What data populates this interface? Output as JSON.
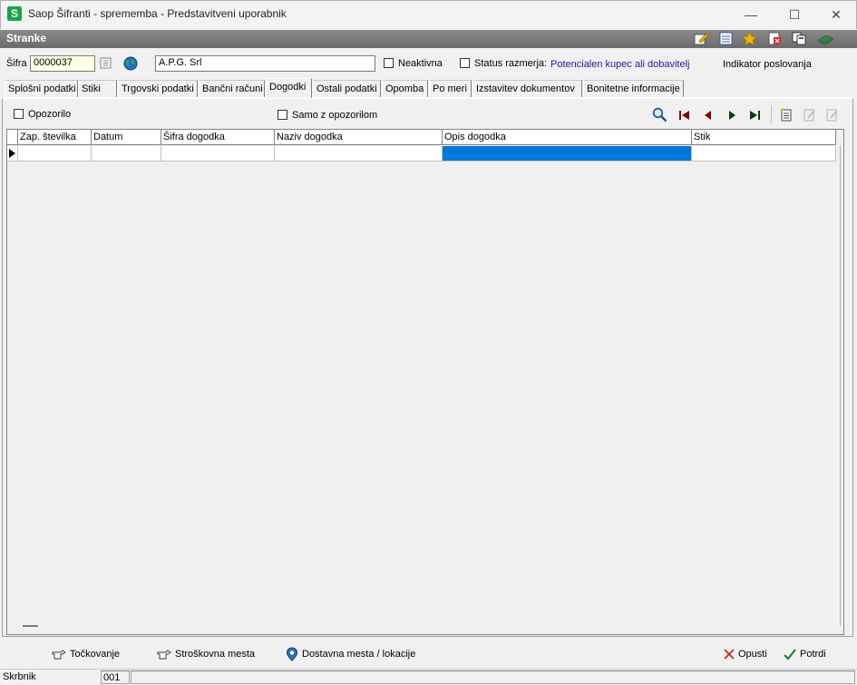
{
  "window": {
    "title": "Saop Šifranti - sprememba - Predstavitveni uporabnik",
    "minimize": "—",
    "maximize": "☐",
    "close": "✕"
  },
  "header": {
    "title": "Stranke"
  },
  "toolbar_icons": [
    "edit-icon",
    "list-icon",
    "star-icon",
    "delete-icon",
    "copy-icon",
    "book-icon"
  ],
  "fields": {
    "sifra_label": "Šifra",
    "sifra_value": "0000037",
    "name_value": "A.P.G. Srl",
    "neaktivna_label": "Neaktivna",
    "status_label": "Status razmerja:",
    "status_value": "Potencialen kupec ali dobavitelj",
    "indikator_label": "Indikator poslovanja"
  },
  "tabs": [
    {
      "label": "Splošni podatki"
    },
    {
      "label": "Stiki"
    },
    {
      "label": "Trgovski podatki"
    },
    {
      "label": "Bančni računi"
    },
    {
      "label": "Dogodki"
    },
    {
      "label": "Ostali podatki"
    },
    {
      "label": "Opomba"
    },
    {
      "label": "Po meri"
    },
    {
      "label": "Izstavitev dokumentov"
    },
    {
      "label": "Bonitetne informacije"
    }
  ],
  "active_tab": "Dogodki",
  "filters": {
    "opozorilo_label": "Opozorilo",
    "samo_label": "Samo z opozorilom"
  },
  "grid": {
    "columns": [
      "Zap. številka",
      "Datum",
      "Šifra dogodka",
      "Naziv dogodka",
      "Opis dogodka",
      "Stik"
    ],
    "rows": [
      [
        "",
        "",
        "",
        "",
        "",
        ""
      ]
    ]
  },
  "bottom": {
    "tockovanje": "Točkovanje",
    "stroskovna": "Stroškovna mesta",
    "dostavna": "Dostavna mesta / lokacije",
    "opusti": "Opusti",
    "potrdi": "Potrdi"
  },
  "statusbar": {
    "user": "Skrbnik",
    "code": "001"
  },
  "colors": {
    "selection": "#0078d7",
    "link_blue": "#1a1aa6",
    "accent_green": "#1aa34a"
  }
}
